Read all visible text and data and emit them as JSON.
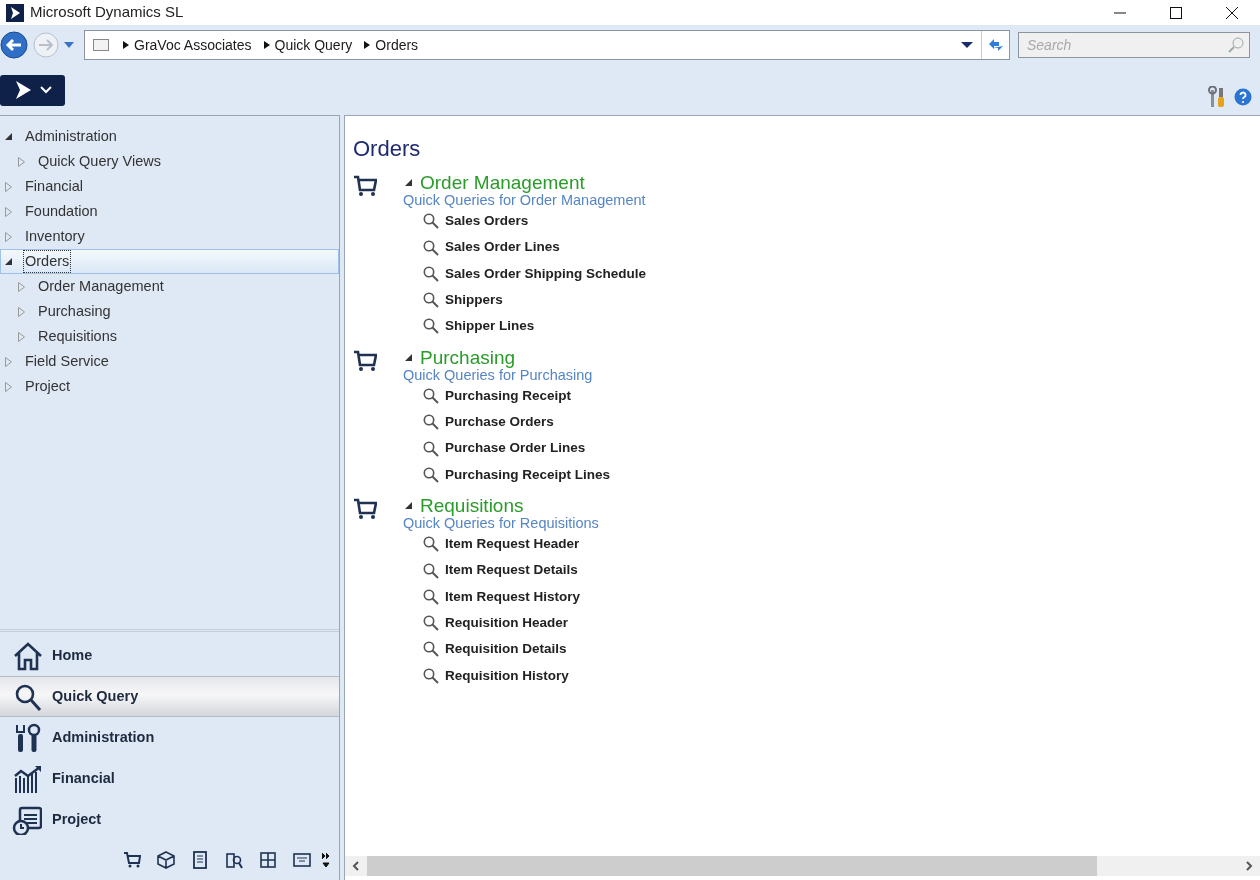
{
  "window": {
    "title": "Microsoft Dynamics SL"
  },
  "address_bar": {
    "breadcrumbs": [
      "GraVoc Associates",
      "Quick Query",
      "Orders"
    ]
  },
  "search": {
    "placeholder": "Search"
  },
  "tree": [
    {
      "label": "Administration",
      "expanded": true,
      "selected": false,
      "children": [
        {
          "label": "Quick Query Views",
          "expanded": false,
          "selected": false
        }
      ]
    },
    {
      "label": "Financial",
      "expanded": false,
      "selected": false
    },
    {
      "label": "Foundation",
      "expanded": false,
      "selected": false
    },
    {
      "label": "Inventory",
      "expanded": false,
      "selected": false
    },
    {
      "label": "Orders",
      "expanded": true,
      "selected": true,
      "children": [
        {
          "label": "Order Management",
          "expanded": false,
          "selected": false
        },
        {
          "label": "Purchasing",
          "expanded": false,
          "selected": false
        },
        {
          "label": "Requisitions",
          "expanded": false,
          "selected": false
        }
      ]
    },
    {
      "label": "Field Service",
      "expanded": false,
      "selected": false
    },
    {
      "label": "Project",
      "expanded": false,
      "selected": false
    }
  ],
  "nav_buttons": [
    {
      "label": "Home",
      "kind": "home",
      "selected": false
    },
    {
      "label": "Quick Query",
      "kind": "search",
      "selected": true
    },
    {
      "label": "Administration",
      "kind": "tools",
      "selected": false
    },
    {
      "label": "Financial",
      "kind": "chart",
      "selected": false
    },
    {
      "label": "Project",
      "kind": "calendar",
      "selected": false
    }
  ],
  "content": {
    "title": "Orders",
    "sections": [
      {
        "title": "Order Management",
        "subtitle": "Quick Queries for Order Management",
        "expanded": true,
        "queries": [
          "Sales Orders",
          "Sales Order Lines",
          "Sales Order Shipping Schedule",
          "Shippers",
          "Shipper Lines"
        ]
      },
      {
        "title": "Purchasing",
        "subtitle": "Quick Queries for Purchasing",
        "expanded": true,
        "queries": [
          "Purchasing Receipt",
          "Purchase Orders",
          "Purchase Order Lines",
          "Purchasing Receipt Lines"
        ]
      },
      {
        "title": "Requisitions",
        "subtitle": "Quick Queries for Requisitions",
        "expanded": true,
        "queries": [
          "Item Request Header",
          "Item Request Details",
          "Item Request History",
          "Requisition Header",
          "Requisition Details",
          "Requisition History"
        ]
      }
    ]
  }
}
